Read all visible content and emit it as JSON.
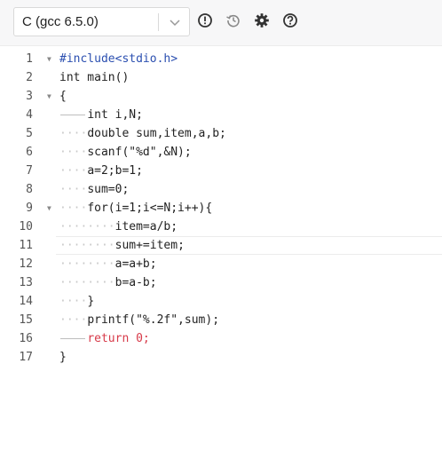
{
  "toolbar": {
    "language_label": "C (gcc 6.5.0)",
    "icons": [
      "info-icon",
      "history-icon",
      "gear-icon",
      "help-icon"
    ]
  },
  "editor": {
    "lines": [
      {
        "num": "1",
        "text": "#include<stdio.h>"
      },
      {
        "num": "2",
        "text": "int main()"
      },
      {
        "num": "3",
        "text": "{"
      },
      {
        "num": "4",
        "text": "int i,N;"
      },
      {
        "num": "5",
        "text": "double sum,item,a,b;"
      },
      {
        "num": "6",
        "text": "scanf(\"%d\",&N);"
      },
      {
        "num": "7",
        "text": "a=2;b=1;"
      },
      {
        "num": "8",
        "text": "sum=0;"
      },
      {
        "num": "9",
        "text": "for(i=1;i<=N;i++){"
      },
      {
        "num": "10",
        "text": "item=a/b;"
      },
      {
        "num": "11",
        "text": "sum+=item;"
      },
      {
        "num": "12",
        "text": "a=a+b;"
      },
      {
        "num": "13",
        "text": "b=a-b;"
      },
      {
        "num": "14",
        "text": "}"
      },
      {
        "num": "15",
        "text": "printf(\"%.2f\",sum);"
      },
      {
        "num": "16",
        "text": "return 0;"
      },
      {
        "num": "17",
        "text": "}"
      }
    ]
  }
}
